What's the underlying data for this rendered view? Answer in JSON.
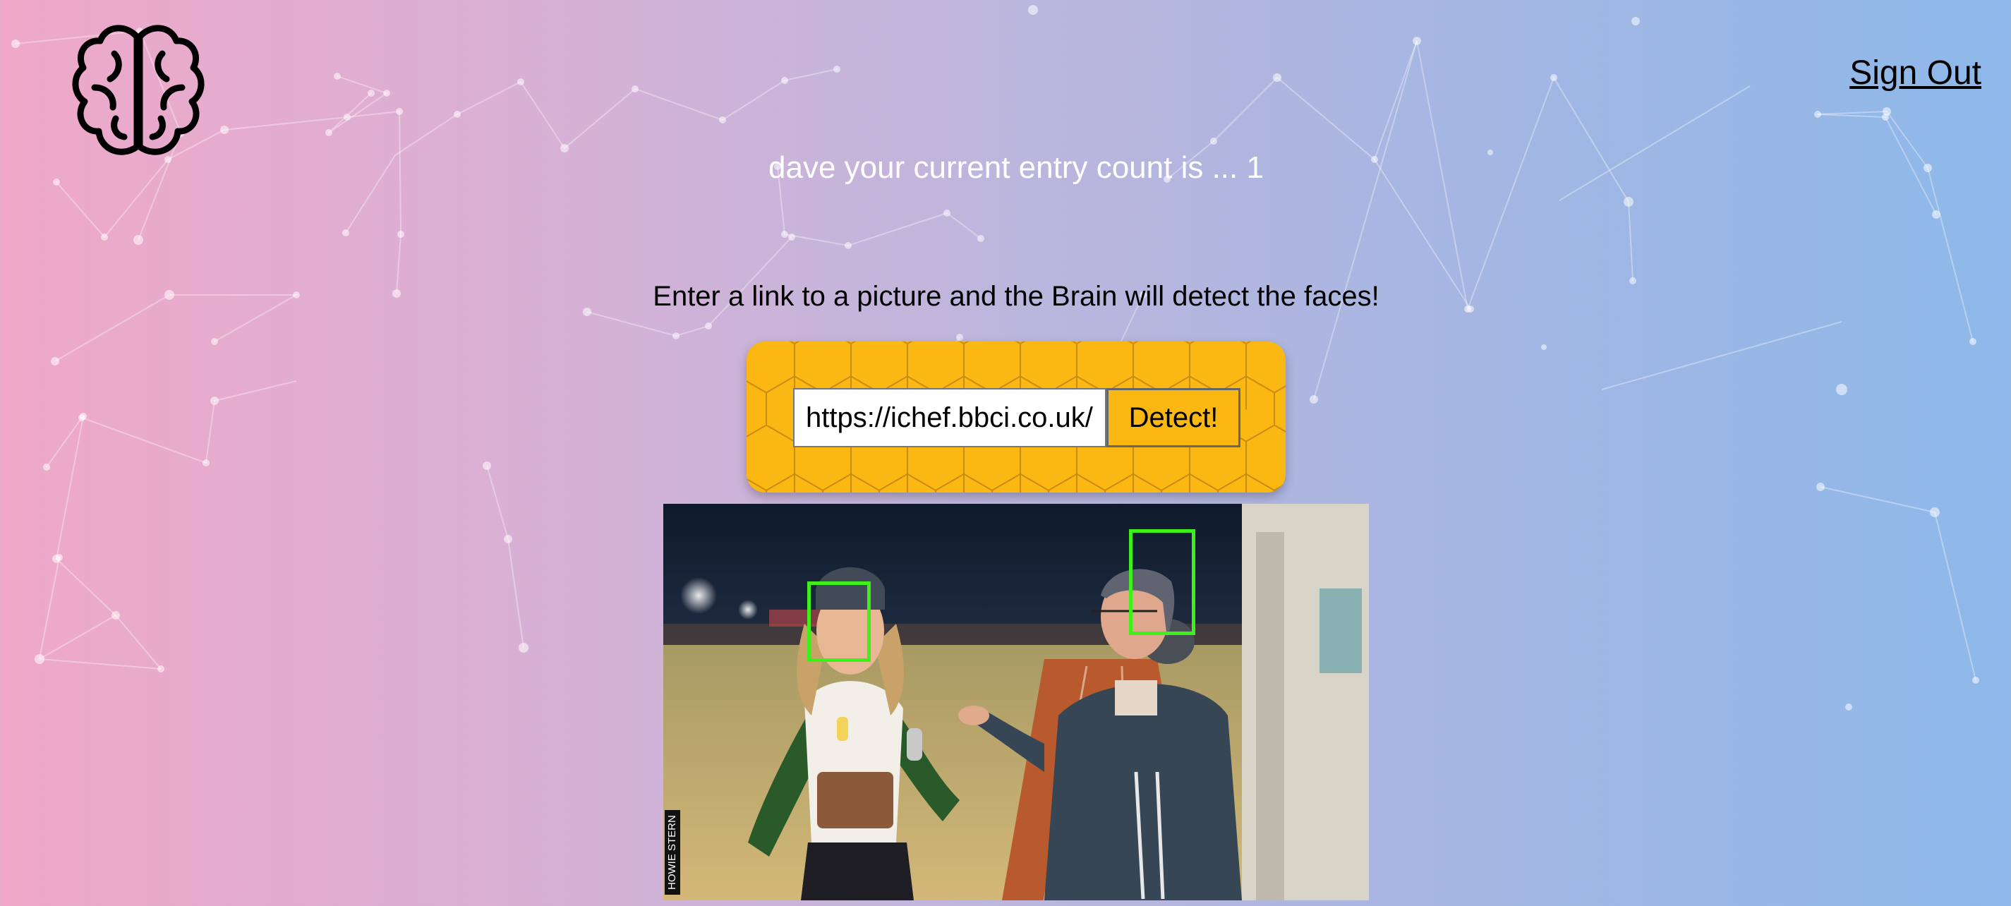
{
  "header": {
    "logo_icon": "brain-icon",
    "sign_out_label": "Sign Out"
  },
  "entry": {
    "message": "dave your current entry count is ... 1"
  },
  "instructions": "Enter a link to a picture and the Brain will detect the faces!",
  "form": {
    "url_value": "https://ichef.bbci.co.uk/",
    "detect_label": "Detect!",
    "background_color": "#fbb813"
  },
  "image": {
    "credit": "HOWIE STERN",
    "face_box_color": "#3ef01a"
  },
  "colors": {
    "gradient_start": "#efa8c8",
    "gradient_end": "#8db8e9"
  }
}
